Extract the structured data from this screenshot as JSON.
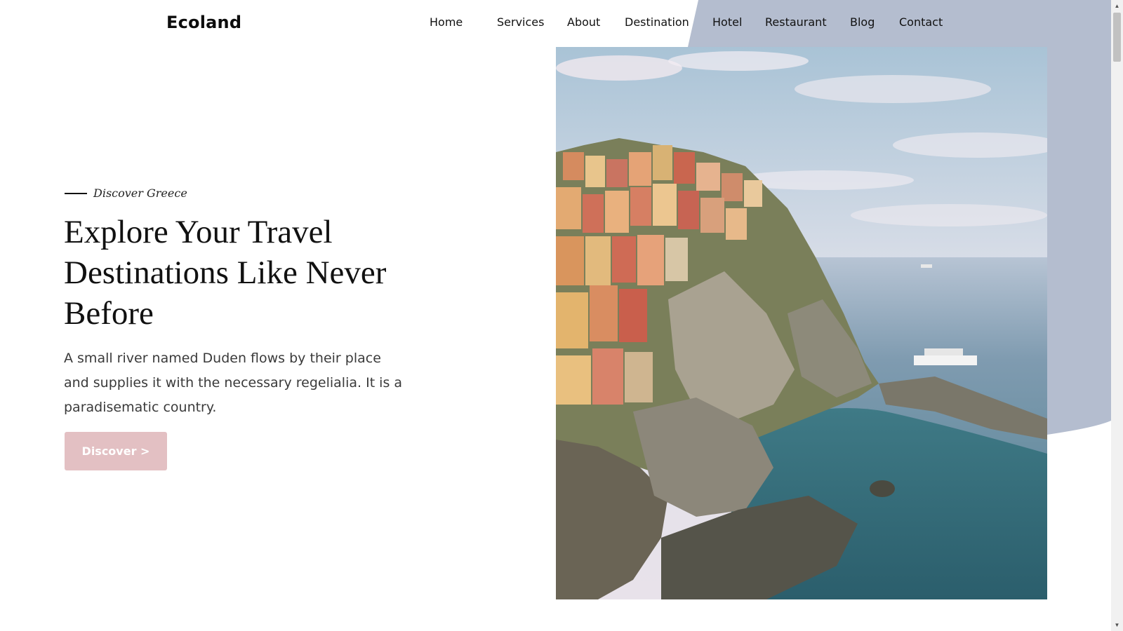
{
  "brand": {
    "logo": "Ecoland"
  },
  "nav": {
    "items": [
      {
        "label": "Home"
      },
      {
        "label": "Services"
      },
      {
        "label": "About"
      },
      {
        "label": "Destination"
      },
      {
        "label": "Hotel"
      },
      {
        "label": "Restaurant"
      },
      {
        "label": "Blog"
      },
      {
        "label": "Contact"
      }
    ]
  },
  "hero": {
    "tag": "Discover Greece",
    "title": "Explore Your Travel Destinations Like Never Before",
    "description": "A small river named Duden flows by their place and supplies it with the necessary regelialia. It is a paradisematic country.",
    "button_label": "Discover >"
  },
  "colors": {
    "accent_shape": "#b4bdcf",
    "button": "#e3c0c3",
    "text": "#111111"
  },
  "icons": {
    "scroll_up": "triangle-up",
    "scroll_down": "triangle-down"
  }
}
